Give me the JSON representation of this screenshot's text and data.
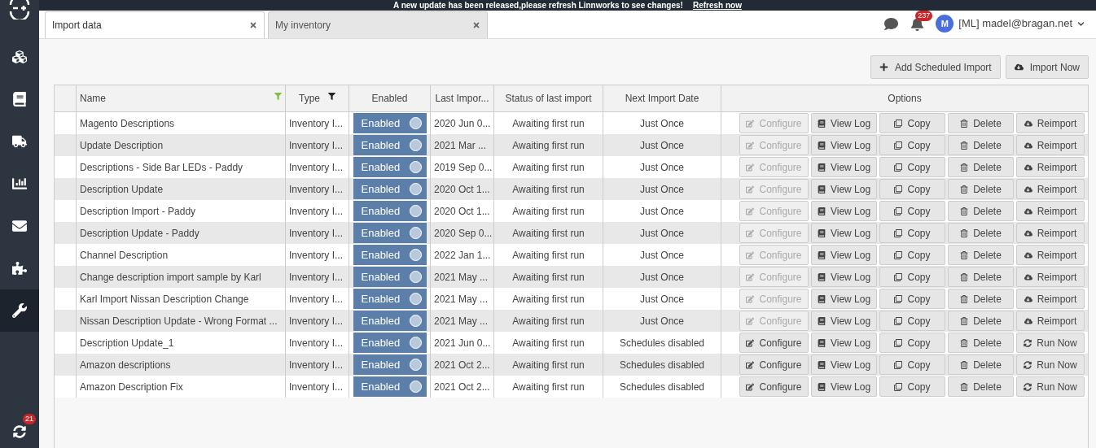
{
  "banner": {
    "message": "A new update has been released,please refresh Linnworks to see changes!",
    "link": "Refresh now"
  },
  "sidebar": {
    "items": [
      {
        "kind": "inventory",
        "selected": false
      },
      {
        "kind": "book",
        "selected": false
      },
      {
        "kind": "shipping",
        "selected": false
      },
      {
        "kind": "reports",
        "selected": false
      },
      {
        "kind": "mail",
        "selected": false
      },
      {
        "kind": "apps",
        "selected": false
      },
      {
        "kind": "settings",
        "selected": true
      }
    ],
    "sync_badge": "21"
  },
  "tabs": [
    {
      "label": "Import data",
      "selected": true
    },
    {
      "label": "My inventory",
      "selected": false
    }
  ],
  "header": {
    "notifications": "237",
    "avatar": "M",
    "user": "[ML] madel@bragan.net"
  },
  "toolbar": [
    {
      "kind": "add",
      "label": "Add Scheduled Import"
    },
    {
      "kind": "import",
      "label": "Import Now"
    }
  ],
  "table": {
    "columns": [
      {
        "label": "Name",
        "filter_active": true
      },
      {
        "label": "Type",
        "filter_active": false
      },
      {
        "label": "Enabled"
      },
      {
        "label": "Last Impor..."
      },
      {
        "label": "Status of last import"
      },
      {
        "label": "Next Import Date"
      },
      {
        "label": "Options"
      }
    ],
    "rows": [
      {
        "name": "Magento Descriptions",
        "type": "Inventory I...",
        "enabled": true,
        "toggle": "Enabled",
        "last": "2020 Jun 0...",
        "status": "Awaiting first run",
        "next": "Just Once",
        "actions": [
          {
            "kind": "configure",
            "label": "Configure",
            "disabled": true
          },
          {
            "kind": "log",
            "label": "View Log",
            "disabled": false
          },
          {
            "kind": "copy",
            "label": "Copy",
            "disabled": false
          },
          {
            "kind": "delete",
            "label": "Delete",
            "disabled": false
          },
          {
            "kind": "reimport",
            "label": "Reimport",
            "disabled": false
          }
        ]
      },
      {
        "name": "Update Description",
        "type": "Inventory I...",
        "enabled": true,
        "toggle": "Enabled",
        "last": "2021 Mar ...",
        "status": "Awaiting first run",
        "next": "Just Once",
        "actions": [
          {
            "kind": "configure",
            "label": "Configure",
            "disabled": true
          },
          {
            "kind": "log",
            "label": "View Log",
            "disabled": false
          },
          {
            "kind": "copy",
            "label": "Copy",
            "disabled": false
          },
          {
            "kind": "delete",
            "label": "Delete",
            "disabled": false
          },
          {
            "kind": "reimport",
            "label": "Reimport",
            "disabled": false
          }
        ]
      },
      {
        "name": "Descriptions - Side Bar LEDs - Paddy",
        "type": "Inventory I...",
        "enabled": true,
        "toggle": "Enabled",
        "last": "2019 Sep 0...",
        "status": "Awaiting first run",
        "next": "Just Once",
        "actions": [
          {
            "kind": "configure",
            "label": "Configure",
            "disabled": true
          },
          {
            "kind": "log",
            "label": "View Log",
            "disabled": false
          },
          {
            "kind": "copy",
            "label": "Copy",
            "disabled": false
          },
          {
            "kind": "delete",
            "label": "Delete",
            "disabled": false
          },
          {
            "kind": "reimport",
            "label": "Reimport",
            "disabled": false
          }
        ]
      },
      {
        "name": "Description Update",
        "type": "Inventory I...",
        "enabled": true,
        "toggle": "Enabled",
        "last": "2020 Oct 1...",
        "status": "Awaiting first run",
        "next": "Just Once",
        "actions": [
          {
            "kind": "configure",
            "label": "Configure",
            "disabled": true
          },
          {
            "kind": "log",
            "label": "View Log",
            "disabled": false
          },
          {
            "kind": "copy",
            "label": "Copy",
            "disabled": false
          },
          {
            "kind": "delete",
            "label": "Delete",
            "disabled": false
          },
          {
            "kind": "reimport",
            "label": "Reimport",
            "disabled": false
          }
        ]
      },
      {
        "name": "Description Import - Paddy",
        "type": "Inventory I...",
        "enabled": true,
        "toggle": "Enabled",
        "last": "2020 Oct 1...",
        "status": "Awaiting first run",
        "next": "Just Once",
        "actions": [
          {
            "kind": "configure",
            "label": "Configure",
            "disabled": true
          },
          {
            "kind": "log",
            "label": "View Log",
            "disabled": false
          },
          {
            "kind": "copy",
            "label": "Copy",
            "disabled": false
          },
          {
            "kind": "delete",
            "label": "Delete",
            "disabled": false
          },
          {
            "kind": "reimport",
            "label": "Reimport",
            "disabled": false
          }
        ]
      },
      {
        "name": "Description Update - Paddy",
        "type": "Inventory I...",
        "enabled": true,
        "toggle": "Enabled",
        "last": "2020 Sep 0...",
        "status": "Awaiting first run",
        "next": "Just Once",
        "actions": [
          {
            "kind": "configure",
            "label": "Configure",
            "disabled": true
          },
          {
            "kind": "log",
            "label": "View Log",
            "disabled": false
          },
          {
            "kind": "copy",
            "label": "Copy",
            "disabled": false
          },
          {
            "kind": "delete",
            "label": "Delete",
            "disabled": false
          },
          {
            "kind": "reimport",
            "label": "Reimport",
            "disabled": false
          }
        ]
      },
      {
        "name": "Channel Description",
        "type": "Inventory I...",
        "enabled": true,
        "toggle": "Enabled",
        "last": "2022 Jan 1...",
        "status": "Awaiting first run",
        "next": "Just Once",
        "actions": [
          {
            "kind": "configure",
            "label": "Configure",
            "disabled": true
          },
          {
            "kind": "log",
            "label": "View Log",
            "disabled": false
          },
          {
            "kind": "copy",
            "label": "Copy",
            "disabled": false
          },
          {
            "kind": "delete",
            "label": "Delete",
            "disabled": false
          },
          {
            "kind": "reimport",
            "label": "Reimport",
            "disabled": false
          }
        ]
      },
      {
        "name": "Change description import sample by Karl",
        "type": "Inventory I...",
        "enabled": true,
        "toggle": "Enabled",
        "last": "2021 May ...",
        "status": "Awaiting first run",
        "next": "Just Once",
        "actions": [
          {
            "kind": "configure",
            "label": "Configure",
            "disabled": true
          },
          {
            "kind": "log",
            "label": "View Log",
            "disabled": false
          },
          {
            "kind": "copy",
            "label": "Copy",
            "disabled": false
          },
          {
            "kind": "delete",
            "label": "Delete",
            "disabled": false
          },
          {
            "kind": "reimport",
            "label": "Reimport",
            "disabled": false
          }
        ]
      },
      {
        "name": "Karl Import Nissan Description Change",
        "type": "Inventory I...",
        "enabled": true,
        "toggle": "Enabled",
        "last": "2021 May ...",
        "status": "Awaiting first run",
        "next": "Just Once",
        "actions": [
          {
            "kind": "configure",
            "label": "Configure",
            "disabled": true
          },
          {
            "kind": "log",
            "label": "View Log",
            "disabled": false
          },
          {
            "kind": "copy",
            "label": "Copy",
            "disabled": false
          },
          {
            "kind": "delete",
            "label": "Delete",
            "disabled": false
          },
          {
            "kind": "reimport",
            "label": "Reimport",
            "disabled": false
          }
        ]
      },
      {
        "name": "Nissan Description Update - Wrong Format ...",
        "type": "Inventory I...",
        "enabled": true,
        "toggle": "Enabled",
        "last": "2021 May ...",
        "status": "Awaiting first run",
        "next": "Just Once",
        "actions": [
          {
            "kind": "configure",
            "label": "Configure",
            "disabled": true
          },
          {
            "kind": "log",
            "label": "View Log",
            "disabled": false
          },
          {
            "kind": "copy",
            "label": "Copy",
            "disabled": false
          },
          {
            "kind": "delete",
            "label": "Delete",
            "disabled": false
          },
          {
            "kind": "reimport",
            "label": "Reimport",
            "disabled": false
          }
        ]
      },
      {
        "name": "Description Update_1",
        "type": "Inventory I...",
        "enabled": true,
        "toggle": "Enabled",
        "last": "2021 Jun 0...",
        "status": "Awaiting first run",
        "next": "Schedules disabled",
        "actions": [
          {
            "kind": "configure",
            "label": "Configure",
            "disabled": false
          },
          {
            "kind": "log",
            "label": "View Log",
            "disabled": false
          },
          {
            "kind": "copy",
            "label": "Copy",
            "disabled": false
          },
          {
            "kind": "delete",
            "label": "Delete",
            "disabled": false
          },
          {
            "kind": "run",
            "label": "Run Now",
            "disabled": false
          }
        ]
      },
      {
        "name": "Amazon descriptions",
        "type": "Inventory I...",
        "enabled": true,
        "toggle": "Enabled",
        "last": "2021 Oct 2...",
        "status": "Awaiting first run",
        "next": "Schedules disabled",
        "actions": [
          {
            "kind": "configure",
            "label": "Configure",
            "disabled": false
          },
          {
            "kind": "log",
            "label": "View Log",
            "disabled": false
          },
          {
            "kind": "copy",
            "label": "Copy",
            "disabled": false
          },
          {
            "kind": "delete",
            "label": "Delete",
            "disabled": false
          },
          {
            "kind": "run",
            "label": "Run Now",
            "disabled": false
          }
        ]
      },
      {
        "name": "Amazon Description Fix",
        "type": "Inventory I...",
        "enabled": true,
        "toggle": "Enabled",
        "last": "2021 Oct 2...",
        "status": "Awaiting first run",
        "next": "Schedules disabled",
        "actions": [
          {
            "kind": "configure",
            "label": "Configure",
            "disabled": false
          },
          {
            "kind": "log",
            "label": "View Log",
            "disabled": false
          },
          {
            "kind": "copy",
            "label": "Copy",
            "disabled": false
          },
          {
            "kind": "delete",
            "label": "Delete",
            "disabled": false
          },
          {
            "kind": "run",
            "label": "Run Now",
            "disabled": false
          }
        ]
      }
    ]
  }
}
